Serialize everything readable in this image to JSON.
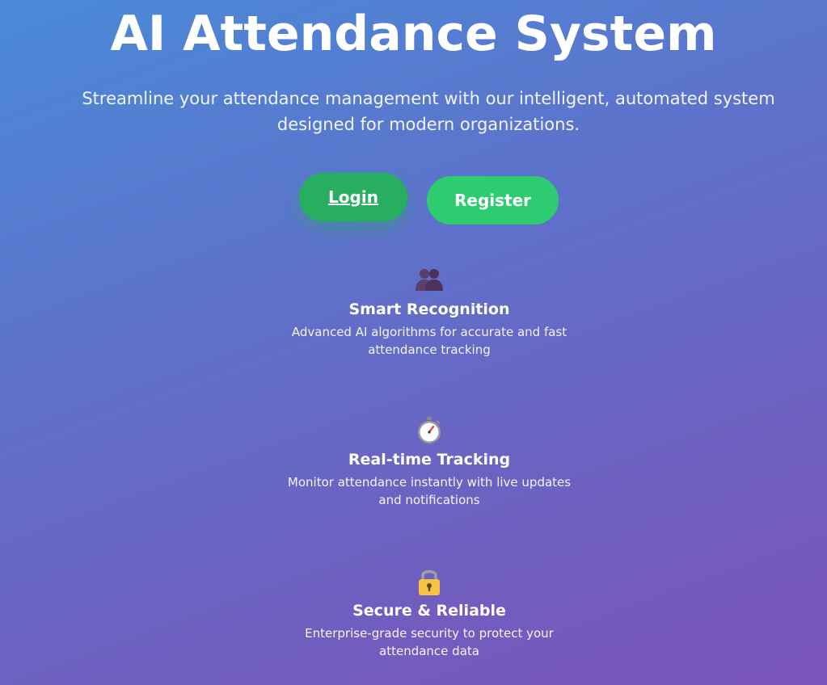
{
  "hero": {
    "title": "AI Attendance System",
    "subtitle": "Streamline your attendance management with our intelligent, automated system designed for modern organizations."
  },
  "actions": {
    "login_label": "Login",
    "register_label": "Register"
  },
  "features": [
    {
      "icon": "two-people-icon",
      "title": "Smart Recognition",
      "description": "Advanced AI algorithms for accurate and fast attendance tracking"
    },
    {
      "icon": "stopwatch-icon",
      "title": "Real-time Tracking",
      "description": "Monitor attendance instantly with live updates and notifications"
    },
    {
      "icon": "lock-icon",
      "title": "Secure & Reliable",
      "description": "Enterprise-grade security to protect your attendance data"
    }
  ],
  "colors": {
    "gradient_start": "#4a8ad8",
    "gradient_end": "#7b54b8",
    "login_button": "#27ae60",
    "register_button": "#2ecc71"
  }
}
